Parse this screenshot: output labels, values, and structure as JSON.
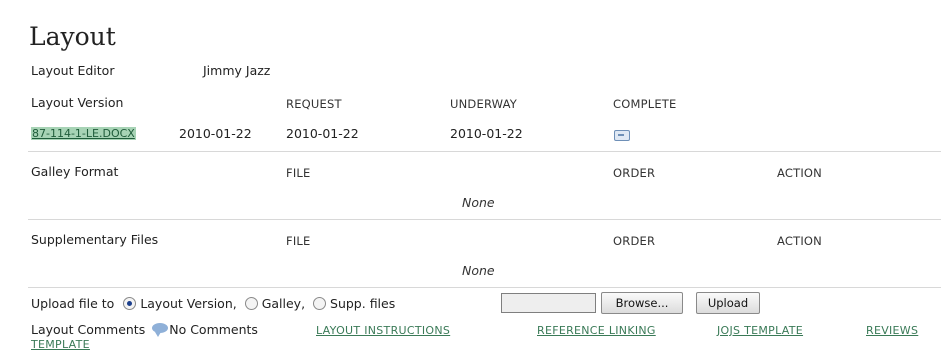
{
  "section_title": "Layout",
  "layout_editor": {
    "label": "Layout Editor",
    "name": "Jimmy Jazz"
  },
  "layout_version": {
    "label": "Layout Version",
    "col_request": "REQUEST",
    "col_underway": "UNDERWAY",
    "col_complete": "COMPLETE",
    "file_link": "87-114-1-LE.DOCX",
    "file_date": "2010-01-22",
    "request_date": "2010-01-22",
    "underway_date": "2010-01-22",
    "complete_icon": "email-icon"
  },
  "galley_format": {
    "label": "Galley Format",
    "col_file": "FILE",
    "col_order": "ORDER",
    "col_action": "ACTION",
    "empty_text": "None"
  },
  "supplementary_files": {
    "label": "Supplementary Files",
    "col_file": "FILE",
    "col_order": "ORDER",
    "col_action": "ACTION",
    "empty_text": "None"
  },
  "upload": {
    "label": "Upload file to",
    "option_layout": "Layout Version,",
    "option_galley": "Galley,",
    "option_supp": "Supp. files",
    "selected": "Layout Version",
    "browse_label": "Browse...",
    "upload_label": "Upload"
  },
  "comments": {
    "label": "Layout Comments",
    "icon": "comment-bubble-icon",
    "status": "No Comments"
  },
  "links": {
    "layout_instructions": "LAYOUT INSTRUCTIONS",
    "reference_linking": "REFERENCE LINKING",
    "jojs_template": "JOJS TEMPLATE",
    "reviews_template_1": "REVIEWS",
    "reviews_template_2": "TEMPLATE"
  },
  "colors": {
    "link": "#3a7a57",
    "file_link_bg": "#a7d3b5",
    "rule": "#d8d8d8"
  }
}
